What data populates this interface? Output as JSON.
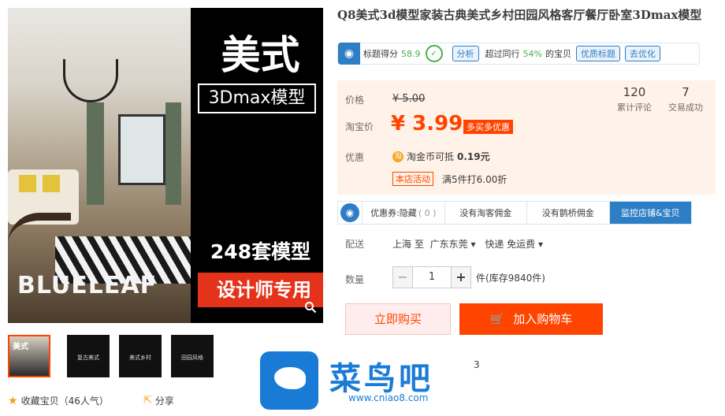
{
  "gallery": {
    "brand": "BLUELEAF",
    "headline": "美式",
    "box_text": "3Dmax模型",
    "count_text": "248套模型",
    "red_text": "设计师专用",
    "zoom_icon": "search-icon",
    "thumbs": [
      {
        "top": "美式",
        "label": ""
      },
      {
        "top": "",
        "label": "复古美式"
      },
      {
        "top": "",
        "label": "美式乡村"
      },
      {
        "top": "",
        "label": "田园风格"
      }
    ]
  },
  "actions": {
    "favorite_label": "收藏宝贝（46人气）",
    "share_label": "分享"
  },
  "product": {
    "title": "Q8美式3d模型家装古典美式乡村田园风格客厅餐厅卧室3Dmax模型"
  },
  "score": {
    "label": "标题得分",
    "value": "58.9",
    "analyze": "分析",
    "beat_prefix": "超过同行",
    "beat_value": "54%",
    "beat_suffix": "的宝贝",
    "optimize_title": "优质标题",
    "go_optimize": "去优化"
  },
  "price": {
    "price_label": "价格",
    "original": "¥ 5.00",
    "taobao_label": "淘宝价",
    "current": "¥ 3.99",
    "multi_discount": "多买多优惠",
    "reviews_count": "120",
    "reviews_label": "累计评论",
    "deals_count": "7",
    "deals_label": "交易成功",
    "promo_label": "优惠",
    "coin_text": "淘金币可抵",
    "coin_value": "0.19元",
    "coin_icon": "淘",
    "shop_promo_tag": "本店活动",
    "shop_promo_text": "满5件打6.00折"
  },
  "tabs": [
    {
      "label": "优惠券:隐藏",
      "extra": "( 0 )"
    },
    {
      "label": "没有淘客佣金",
      "extra": ""
    },
    {
      "label": "没有鹊桥佣金",
      "extra": ""
    },
    {
      "label": "监控店铺&宝贝",
      "extra": ""
    }
  ],
  "shipping": {
    "label": "配送",
    "from": "上海 至",
    "to": "广东东莞",
    "method": "快递 免运费"
  },
  "quantity": {
    "label": "数量",
    "value": "1",
    "stock": "件(库存9840件)"
  },
  "buttons": {
    "buy_now": "立即购买",
    "add_cart": "加入购物车"
  },
  "watermark": {
    "text": "菜鸟吧",
    "url": "www.cniao8.com",
    "peek": "3"
  },
  "colors": {
    "accent": "#ff4400",
    "blue": "#2e7ec6",
    "green": "#49b14a"
  }
}
